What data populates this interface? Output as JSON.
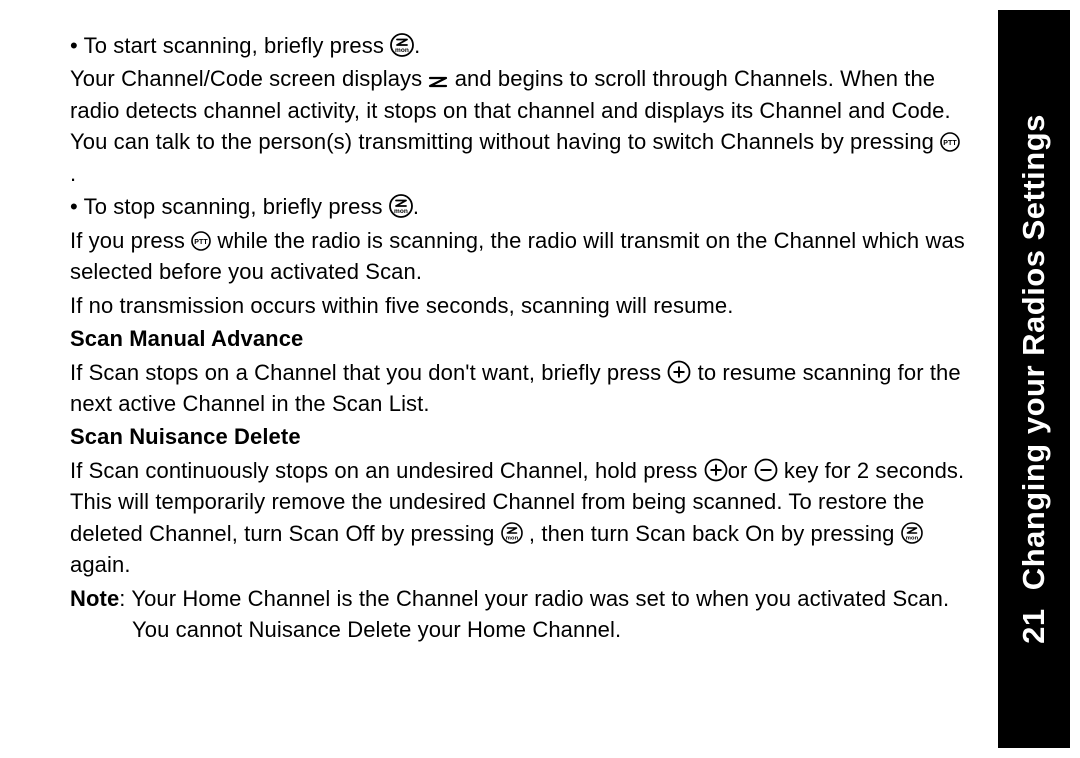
{
  "sidebar": {
    "page_number": "21",
    "section_title": "Changing your Radios Settings"
  },
  "body": {
    "p1_part1": "• To start scanning, briefly press",
    "p1_part2": ".",
    "p2_part1": "Your Channel/Code screen displays ",
    "p2_part2": " and begins to scroll through Channels. When the radio detects channel activity, it stops on that channel and displays its Channel and Code. You can talk to the person(s) transmitting without having to switch Channels by pressing ",
    "p2_part3": " .",
    "p3_part1": "• To stop scanning, briefly press",
    "p3_part2": ".",
    "p4_part1": "If you press ",
    "p4_part2": " while the radio is scanning, the radio will transmit on the Channel which was selected before you activated Scan.",
    "p5": "If no transmission occurs within five seconds, scanning will resume.",
    "h1": "Scan Manual Advance",
    "p6_part1": "If Scan stops on a Channel that you don't want, briefly press ",
    "p6_part2": " to resume scanning for the next active Channel in the Scan List.",
    "h2": "Scan Nuisance Delete",
    "p7_part1": "If Scan continuously stops on an undesired Channel, hold press ",
    "p7_part2": "or ",
    "p7_part3": " key for 2 seconds. This will temporarily remove the undesired Channel from being scanned. To restore the deleted Channel, turn Scan Off by pressing ",
    "p7_part4": " , then turn Scan back On by pressing ",
    "p7_part5": " again.",
    "p8_label": "Note",
    "p8_text": ": Your Home Channel is the Channel your radio was set to when you activated Scan. You cannot Nuisance Delete your Home Channel."
  }
}
